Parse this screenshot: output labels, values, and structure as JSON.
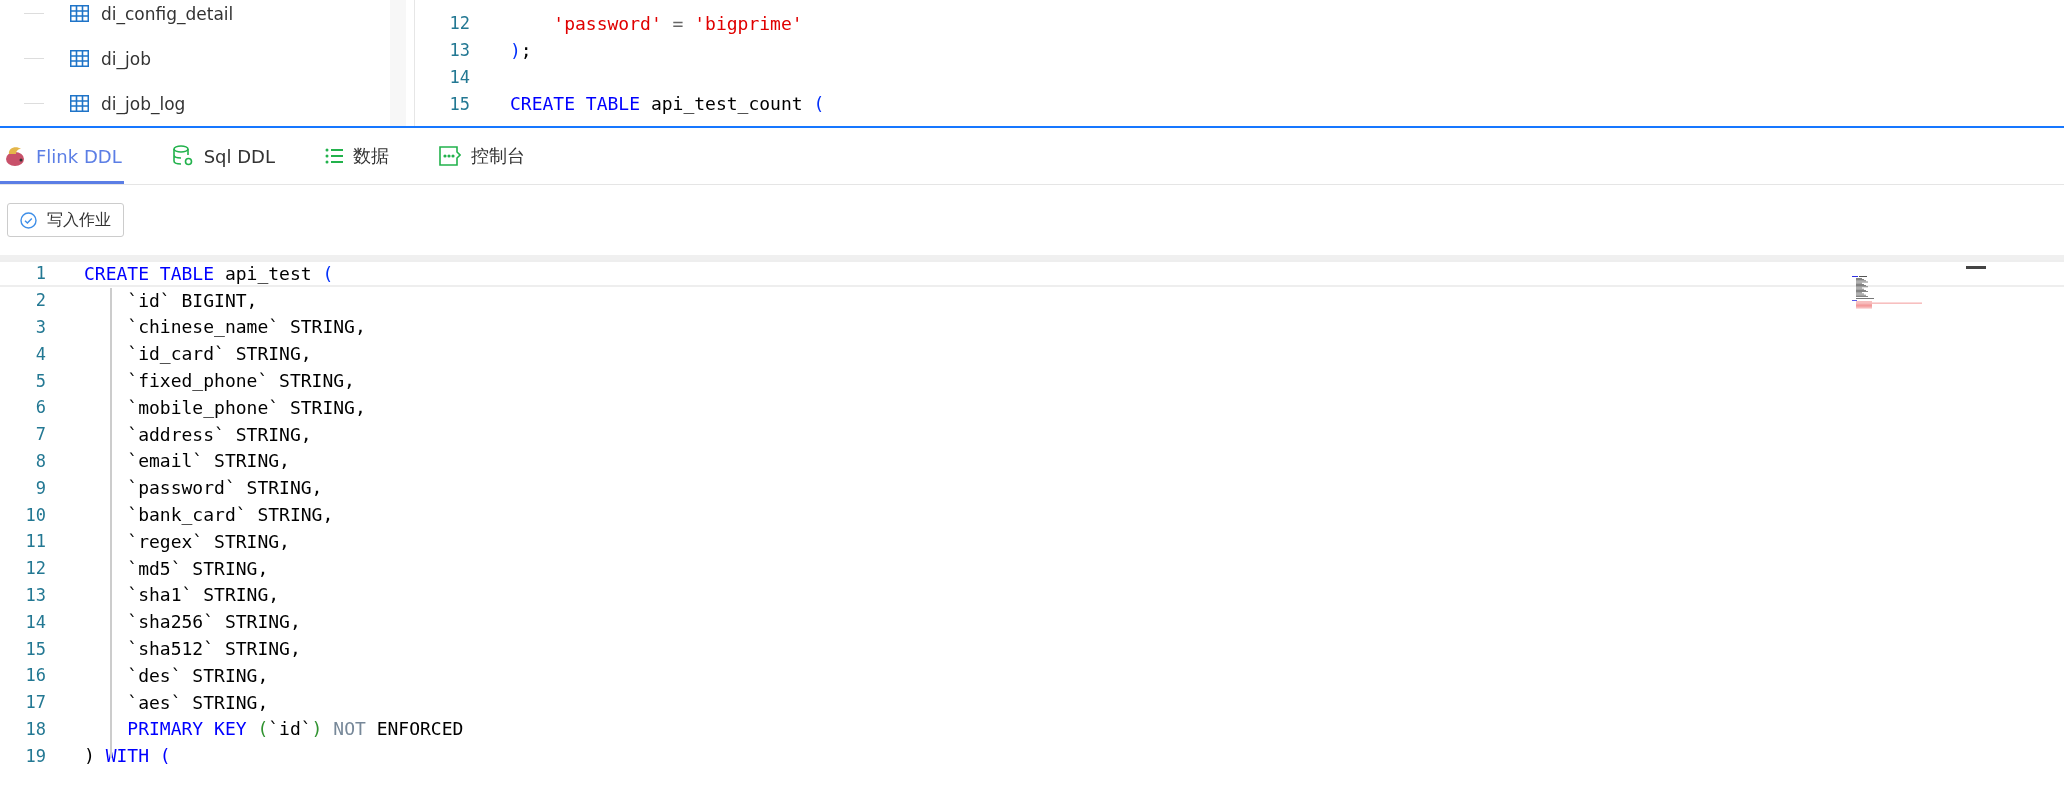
{
  "sidebar": {
    "items": [
      {
        "label": "di_config_detail"
      },
      {
        "label": "di_job"
      },
      {
        "label": "di_job_log"
      }
    ]
  },
  "top_editor": {
    "lines": [
      {
        "number": "12",
        "tokens": [
          {
            "t": "    'password'",
            "kind": "str"
          },
          {
            "t": " = ",
            "kind": "op"
          },
          {
            "t": "'bigprime'",
            "kind": "str"
          }
        ]
      },
      {
        "number": "13",
        "tokens": [
          {
            "t": ")",
            "kind": "br"
          },
          {
            "t": ";",
            "kind": "id"
          }
        ]
      },
      {
        "number": "14"
      },
      {
        "number": "15",
        "tokens": [
          {
            "t": "CREATE TABLE",
            "kind": "kw"
          },
          {
            "t": " api_test_count ",
            "kind": "id"
          },
          {
            "t": "(",
            "kind": "br"
          }
        ]
      }
    ]
  },
  "tabs": [
    {
      "label": "Flink DDL",
      "selected": true
    },
    {
      "label": "Sql DDL",
      "selected": false
    },
    {
      "label": "数据",
      "selected": false
    },
    {
      "label": "控制台",
      "selected": false
    }
  ],
  "toolbar": {
    "button": "写入作业"
  },
  "editor": {
    "lines": [
      {
        "number": "1",
        "current": true,
        "tokens": [
          {
            "t": "CREATE TABLE",
            "kind": "kw"
          },
          {
            "t": " api_test ",
            "kind": "id"
          },
          {
            "t": "(",
            "kind": "br"
          }
        ]
      },
      {
        "number": "2",
        "current": false,
        "tokens": [
          {
            "t": "    `id` BIGINT,",
            "kind": "id"
          }
        ]
      },
      {
        "number": "3",
        "current": false,
        "tokens": [
          {
            "t": "    `chinese_name` STRING,",
            "kind": "id"
          }
        ]
      },
      {
        "number": "4",
        "current": false,
        "tokens": [
          {
            "t": "    `id_card` STRING,",
            "kind": "id"
          }
        ]
      },
      {
        "number": "5",
        "current": false,
        "tokens": [
          {
            "t": "    `fixed_phone` STRING,",
            "kind": "id"
          }
        ]
      },
      {
        "number": "6",
        "current": false,
        "tokens": [
          {
            "t": "    `mobile_phone` STRING,",
            "kind": "id"
          }
        ]
      },
      {
        "number": "7",
        "current": false,
        "tokens": [
          {
            "t": "    `address` STRING,",
            "kind": "id"
          }
        ]
      },
      {
        "number": "8",
        "current": false,
        "tokens": [
          {
            "t": "    `email` STRING,",
            "kind": "id"
          }
        ]
      },
      {
        "number": "9",
        "current": false,
        "tokens": [
          {
            "t": "    `password` STRING,",
            "kind": "id"
          }
        ]
      },
      {
        "number": "10",
        "current": false,
        "tokens": [
          {
            "t": "    `bank_card` STRING,",
            "kind": "id"
          }
        ]
      },
      {
        "number": "11",
        "current": false,
        "tokens": [
          {
            "t": "    `regex` STRING,",
            "kind": "id"
          }
        ]
      },
      {
        "number": "12",
        "current": false,
        "tokens": [
          {
            "t": "    `md5` STRING,",
            "kind": "id"
          }
        ]
      },
      {
        "number": "13",
        "current": false,
        "tokens": [
          {
            "t": "    `sha1` STRING,",
            "kind": "id"
          }
        ]
      },
      {
        "number": "14",
        "current": false,
        "tokens": [
          {
            "t": "    `sha256` STRING,",
            "kind": "id"
          }
        ]
      },
      {
        "number": "15",
        "current": false,
        "tokens": [
          {
            "t": "    `sha512` STRING,",
            "kind": "id"
          }
        ]
      },
      {
        "number": "16",
        "current": false,
        "tokens": [
          {
            "t": "    `des` STRING,",
            "kind": "id"
          }
        ]
      },
      {
        "number": "17",
        "current": false,
        "tokens": [
          {
            "t": "    `aes` STRING,",
            "kind": "id"
          }
        ]
      },
      {
        "number": "18",
        "current": false,
        "tokens": [
          {
            "t": "    PRIMARY KEY",
            "kind": "kw"
          },
          {
            "t": " (",
            "kind": "br2"
          },
          {
            "t": "`id`",
            "kind": "id"
          },
          {
            "t": ")",
            "kind": "br2"
          },
          {
            "t": " NOT",
            "kind": "dim"
          },
          {
            "t": " ENFORCED",
            "kind": "id"
          }
        ]
      },
      {
        "number": "19",
        "current": false,
        "tokens": [
          {
            "t": ")",
            "kind": "id"
          },
          {
            "t": " WITH (",
            "kind": "kw"
          }
        ]
      }
    ]
  }
}
